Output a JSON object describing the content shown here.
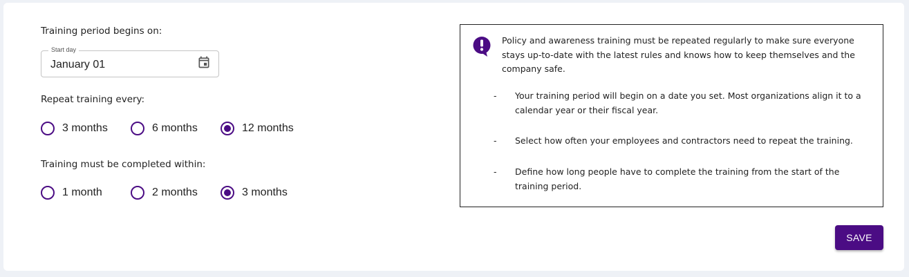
{
  "colors": {
    "accent": "#4b0c84",
    "background": "#eef1f6",
    "card": "#ffffff"
  },
  "start": {
    "label": "Training period begins on:",
    "field_legend": "Start day",
    "field_value": "January 01",
    "icon": "calendar-icon"
  },
  "repeat": {
    "label": "Repeat training every:",
    "options": [
      {
        "label": "3 months",
        "selected": false
      },
      {
        "label": "6 months",
        "selected": false
      },
      {
        "label": "12 months",
        "selected": true
      }
    ]
  },
  "complete": {
    "label": "Training must be completed within:",
    "options": [
      {
        "label": "1 month",
        "selected": false
      },
      {
        "label": "2 months",
        "selected": false
      },
      {
        "label": "3 months",
        "selected": true
      }
    ]
  },
  "info": {
    "icon": "exclamation-speech-bubble-icon",
    "intro": "Policy and awareness training must be repeated regularly to make sure everyone stays up-to-date with the latest rules and knows how to keep themselves and the company safe.",
    "bullets": [
      {
        "dash": "-",
        "text": "Your training period will begin on a date you set. Most organizations align it to a calendar year or their fiscal year."
      },
      {
        "dash": "-",
        "text": "Select how often your employees and contractors need to repeat the training."
      },
      {
        "dash": "-",
        "text": "Define how long people have to complete the training from the start of the training period."
      }
    ]
  },
  "actions": {
    "save_label": "SAVE"
  }
}
